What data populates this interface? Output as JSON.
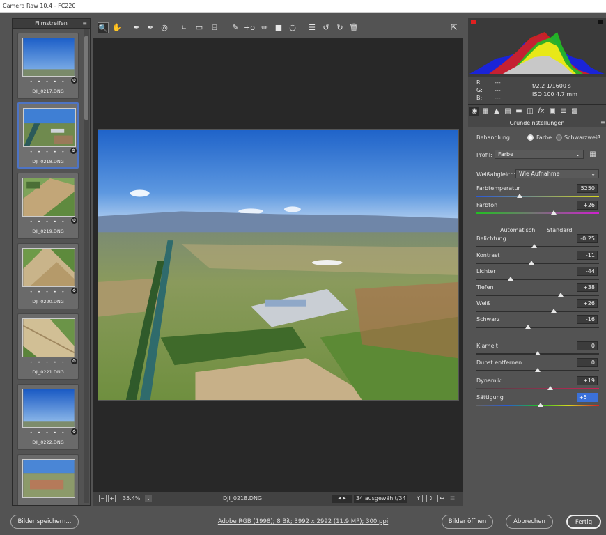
{
  "window": {
    "title": "Camera Raw 10.4  -  FC220"
  },
  "filmstrip": {
    "title": "Filmstreifen",
    "menu_icon": "menu-icon",
    "rating_dots": "• • • • •",
    "thumbs": [
      {
        "name": "DJI_0217.DNG"
      },
      {
        "name": "DJI_0218.DNG"
      },
      {
        "name": "DJI_0219.DNG"
      },
      {
        "name": "DJI_0220.DNG"
      },
      {
        "name": "DJI_0221.DNG"
      },
      {
        "name": "DJI_0222.DNG"
      },
      {
        "name": ""
      }
    ]
  },
  "toolbar": {
    "icons": [
      "zoom-icon",
      "hand-icon",
      "white-balance-icon",
      "color-sampler-icon",
      "target-adjust-icon",
      "crop-icon",
      "straighten-icon",
      "transform-icon",
      "spot-removal-icon",
      "red-eye-icon",
      "adjustment-brush-icon",
      "graduated-filter-icon",
      "radial-filter-icon",
      "presets-list-icon",
      "rotate-left-icon",
      "rotate-right-icon",
      "trash-icon",
      "fullscreen-icon"
    ],
    "glyphs": {
      "zoom": "🔍",
      "hand": "✋",
      "wb": "✒",
      "sampler": "✒",
      "target": "◎",
      "crop": "⌗",
      "straighten": "▭",
      "transform": "⌸",
      "spot": "✎",
      "redeye": "+o",
      "brush": "✏",
      "grad": "■",
      "radial": "○",
      "list": "☰",
      "rotl": "↺",
      "rotr": "↻",
      "trash": "🗑",
      "full": "⇱"
    }
  },
  "status": {
    "zoom_minus": "−",
    "zoom_plus": "+",
    "zoom": "35.4%",
    "filename": "DJI_0218.DNG",
    "selection": "34 ausgewählt/34",
    "prev": "◀",
    "next": "▶",
    "y_label": "Y"
  },
  "exif": {
    "r": "R:",
    "g": "G:",
    "b": "B:",
    "dash": "---",
    "aperture_shutter": "f/2.2   1/1600 s",
    "iso_focal": "ISO 100   4.7 mm"
  },
  "panel": {
    "tab_icons": [
      "basic-icon",
      "tone-curve-icon",
      "detail-icon",
      "hsl-icon",
      "split-toning-icon",
      "lens-icon",
      "fx-icon",
      "calibration-icon",
      "presets-icon",
      "snapshots-icon"
    ],
    "section": "Grundeinstellungen",
    "behandlung_label": "Behandlung:",
    "farbe": "Farbe",
    "sw": "Schwarzweiß",
    "profil_label": "Profil:",
    "profil_value": "Farbe",
    "wb_label": "Weißabgleich:",
    "wb_value": "Wie Aufnahme",
    "auto": "Automatisch",
    "standard": "Standard",
    "sliders": [
      {
        "label": "Farbtemperatur",
        "value": "5250",
        "pos": 0.35
      },
      {
        "label": "Farbton",
        "value": "+26",
        "pos": 0.63
      },
      {
        "label": "Belichtung",
        "value": "-0.25",
        "pos": 0.47
      },
      {
        "label": "Kontrast",
        "value": "-11",
        "pos": 0.45
      },
      {
        "label": "Lichter",
        "value": "-44",
        "pos": 0.28
      },
      {
        "label": "Tiefen",
        "value": "+38",
        "pos": 0.69
      },
      {
        "label": "Weiß",
        "value": "+26",
        "pos": 0.63
      },
      {
        "label": "Schwarz",
        "value": "-16",
        "pos": 0.42
      },
      {
        "label": "Klarheit",
        "value": "0",
        "pos": 0.5
      },
      {
        "label": "Dunst entfernen",
        "value": "0",
        "pos": 0.5
      },
      {
        "label": "Dynamik",
        "value": "+19",
        "pos": 0.6
      },
      {
        "label": "Sättigung",
        "value": "+5",
        "pos": 0.52
      }
    ]
  },
  "footer": {
    "save": "Bilder speichern...",
    "info": "Adobe RGB (1998); 8 Bit; 3992 x 2992 (11.9 MP); 300 ppi",
    "open": "Bilder öffnen",
    "cancel": "Abbrechen",
    "done": "Fertig"
  },
  "colors": {
    "accent": "#3b71d8",
    "selection_border": "#4e74c4"
  }
}
